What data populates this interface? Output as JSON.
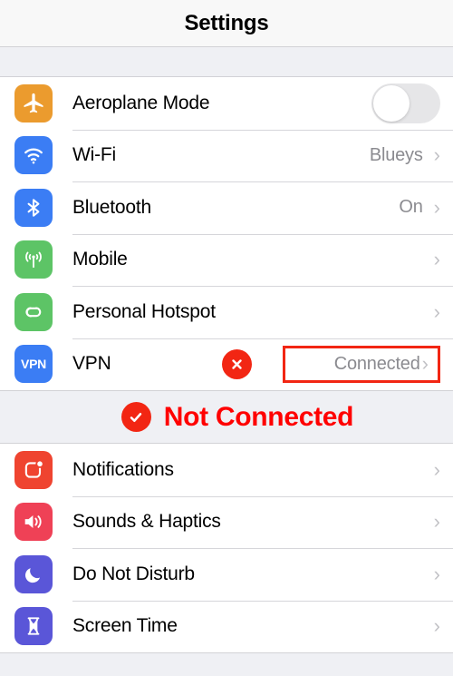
{
  "header": {
    "title": "Settings"
  },
  "groups": [
    {
      "name": "connectivity",
      "rows": [
        {
          "icon": "airplane-icon",
          "label": "Aeroplane Mode",
          "control": "toggle",
          "toggle_on": false
        },
        {
          "icon": "wifi-icon",
          "label": "Wi-Fi",
          "value": "Blueys",
          "chevron": "›"
        },
        {
          "icon": "bluetooth-icon",
          "label": "Bluetooth",
          "value": "On",
          "chevron": "›"
        },
        {
          "icon": "mobile-icon",
          "label": "Mobile",
          "value": "",
          "chevron": "›"
        },
        {
          "icon": "personal-hotspot-icon",
          "label": "Personal Hotspot",
          "value": "",
          "chevron": "›"
        },
        {
          "icon": "vpn-icon",
          "icon_text": "VPN",
          "label": "VPN",
          "value": "Connected",
          "chevron": "›",
          "annotated": true
        }
      ]
    },
    {
      "name": "system",
      "rows": [
        {
          "icon": "notifications-icon",
          "label": "Notifications",
          "value": "",
          "chevron": "›"
        },
        {
          "icon": "sounds-icon",
          "label": "Sounds & Haptics",
          "value": "",
          "chevron": "›"
        },
        {
          "icon": "do-not-disturb-icon",
          "label": "Do Not Disturb",
          "value": "",
          "chevron": "›"
        },
        {
          "icon": "screen-time-icon",
          "label": "Screen Time",
          "value": "",
          "chevron": "›"
        }
      ]
    }
  ],
  "annotations": {
    "x_marker": "✕",
    "check_marker": "✓",
    "banner_text": "Not Connected",
    "highlight_color": "#f22613",
    "banner_text_color": "#ff0000"
  }
}
